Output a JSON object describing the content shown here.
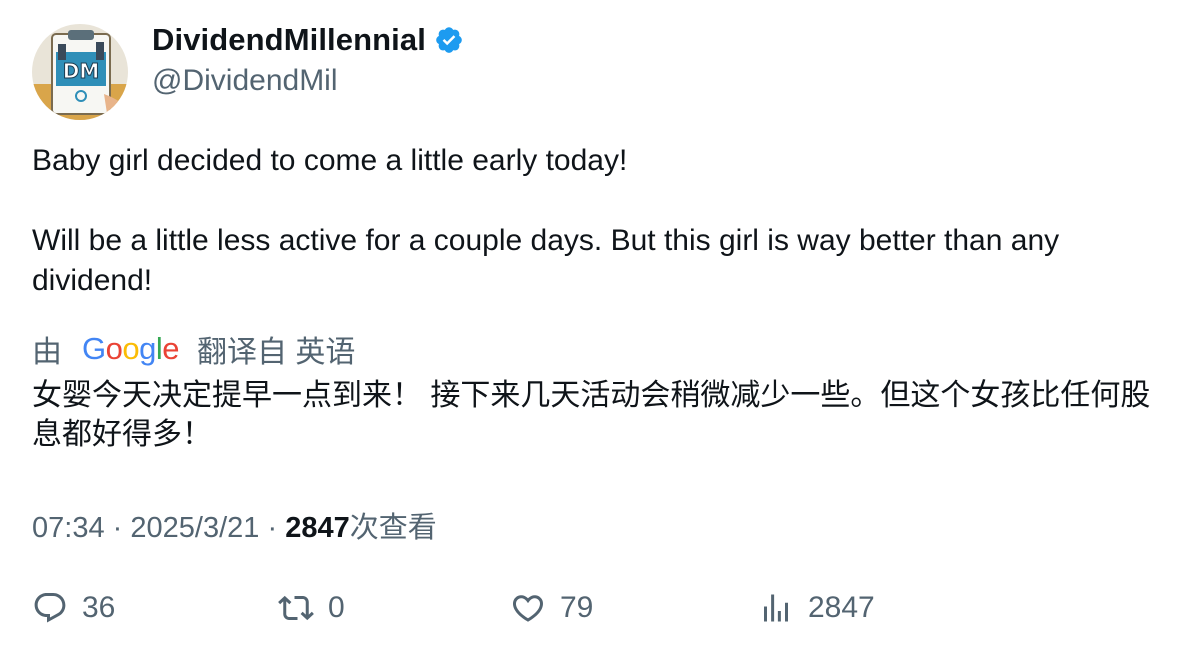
{
  "author": {
    "display_name": "DividendMillennial",
    "handle": "@DividendMil",
    "avatar_icon": "dm-logo-avatar",
    "verified": true,
    "verified_color": "#1d9bf0"
  },
  "tweet": {
    "line1": "Baby girl decided to come a little early today!",
    "line2": "Will be a little less active for a couple days.  But this girl is way better than any dividend!"
  },
  "translation": {
    "prefix": "由",
    "brand": "Google",
    "suffix": "翻译自 英语",
    "text": "女婴今天决定提早一点到来！ 接下来几天活动会稍微减少一些。但这个女孩比任何股息都好得多！"
  },
  "meta": {
    "time": "07:34",
    "separator": "·",
    "date": "2025/3/21",
    "views_count": "2847",
    "views_label": "次查看"
  },
  "actions": {
    "replies": "36",
    "retweets": "0",
    "likes": "79",
    "views": "2847"
  }
}
